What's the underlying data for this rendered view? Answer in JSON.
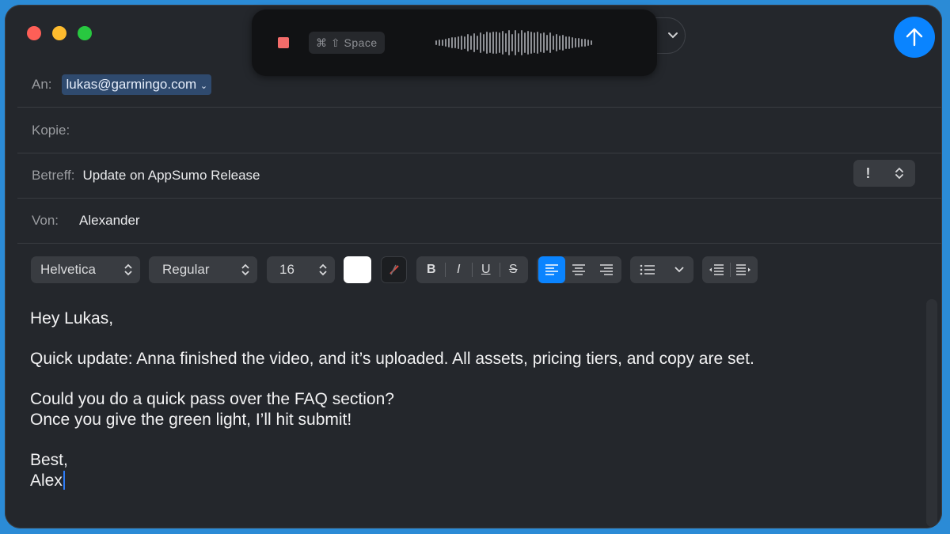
{
  "header": {
    "to_label": "An:",
    "to_address": "lukas@garmingo.com",
    "cc_label": "Kopie:",
    "subject_label": "Betreff:",
    "subject": "Update on AppSumo Release",
    "from_label": "Von:",
    "from": "Alexander",
    "priority_symbol": "!"
  },
  "dictation": {
    "shortcut": "⌘ ⇧ Space"
  },
  "toolbar": {
    "font_family": "Helvetica",
    "font_style": "Regular",
    "font_size": "16",
    "bold": "B",
    "italic": "I",
    "underline": "U",
    "strike": "S"
  },
  "message": {
    "greeting": "Hey Lukas,",
    "p1": "Quick update: Anna finished the video, and it’s uploaded. All assets, pricing tiers, and copy are set.",
    "p2_line1": "Could you do a quick pass over the FAQ section?",
    "p2_line2": "Once you give the green light, I’ll hit submit!",
    "closing": "Best,",
    "signature": "Alex"
  },
  "colors": {
    "window_bg": "#24272c",
    "accent": "#0a84ff",
    "desktop": "#2b8bd6"
  }
}
